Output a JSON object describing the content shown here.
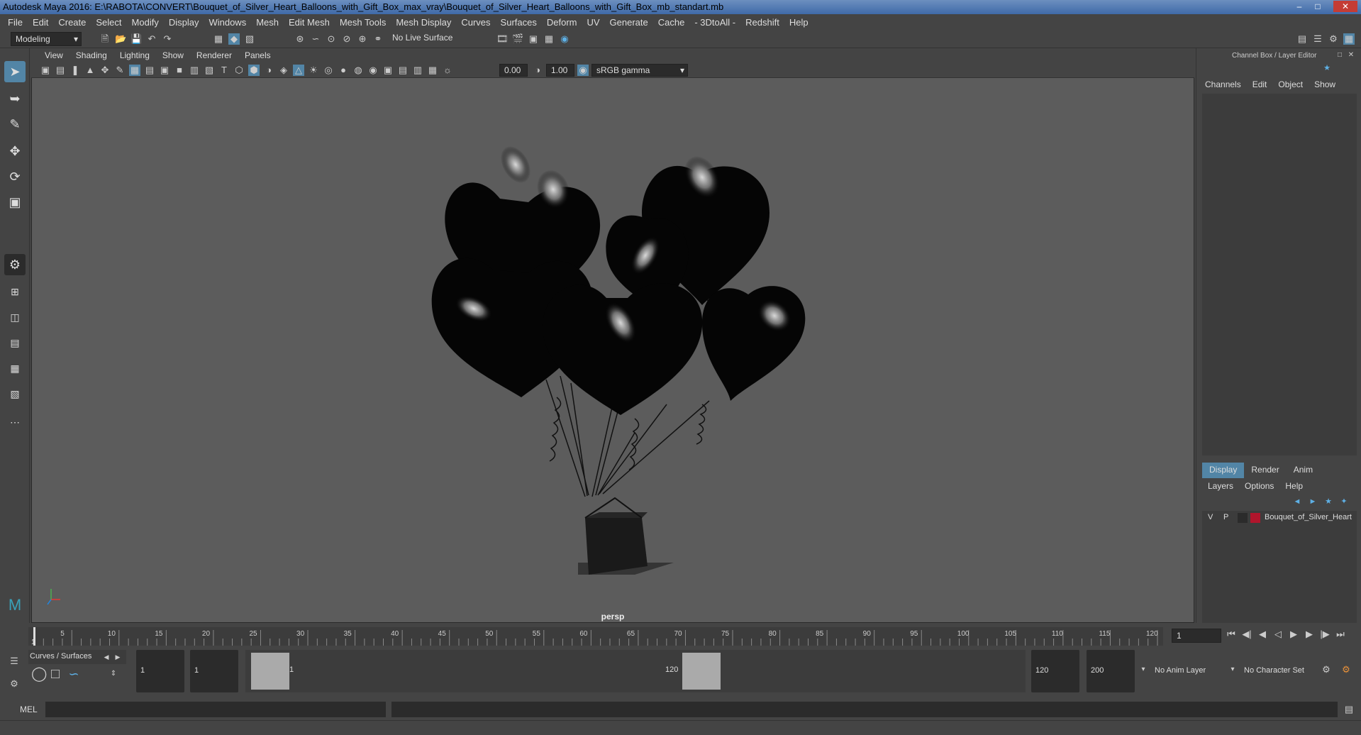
{
  "window": {
    "title": "Autodesk Maya 2016: E:\\RABOTA\\CONVERT\\Bouquet_of_Silver_Heart_Balloons_with_Gift_Box_max_vray\\Bouquet_of_Silver_Heart_Balloons_with_Gift_Box_mb_standart.mb"
  },
  "menubar": [
    "File",
    "Edit",
    "Create",
    "Select",
    "Modify",
    "Display",
    "Windows",
    "Mesh",
    "Edit Mesh",
    "Mesh Tools",
    "Mesh Display",
    "Curves",
    "Surfaces",
    "Deform",
    "UV",
    "Generate",
    "Cache",
    "- 3DtoAll -",
    "Redshift",
    "Help"
  ],
  "shelf": {
    "mode": "Modeling",
    "live_surface": "No Live Surface"
  },
  "panel_menu": [
    "View",
    "Shading",
    "Lighting",
    "Show",
    "Renderer",
    "Panels"
  ],
  "panel_tools": {
    "exposure": "0.00",
    "gamma": "1.00",
    "color_space": "sRGB gamma"
  },
  "viewport": {
    "camera_label": "persp"
  },
  "channel_box": {
    "title": "Channel Box / Layer Editor",
    "menu": [
      "Channels",
      "Edit",
      "Object",
      "Show"
    ]
  },
  "layer_editor": {
    "tabs": [
      "Display",
      "Render",
      "Anim"
    ],
    "menu": [
      "Layers",
      "Options",
      "Help"
    ],
    "layer": {
      "v": "V",
      "p": "P",
      "name": "Bouquet_of_Silver_Heart",
      "color": "#b0152c"
    }
  },
  "timeline": {
    "ticks": [
      "5",
      "10",
      "15",
      "20",
      "25",
      "30",
      "35",
      "40",
      "45",
      "50",
      "55",
      "60",
      "65",
      "70",
      "75",
      "80",
      "85",
      "90",
      "95",
      "100",
      "105",
      "110",
      "115",
      "120"
    ],
    "start_label": "1",
    "current_frame": "1"
  },
  "range": {
    "shelf_tab": "Curves / Surfaces",
    "start_time": "1",
    "playback_start": "1",
    "slider_start": "1",
    "slider_end": "120",
    "playback_end": "120",
    "end_time": "200",
    "anim_layer": "No Anim Layer",
    "character_set": "No Character Set"
  },
  "cmdline": {
    "label": "MEL"
  },
  "colors": {
    "viewport_bg": "#5c5c5c",
    "ui_bg": "#444444",
    "accent": "#5285a6"
  }
}
